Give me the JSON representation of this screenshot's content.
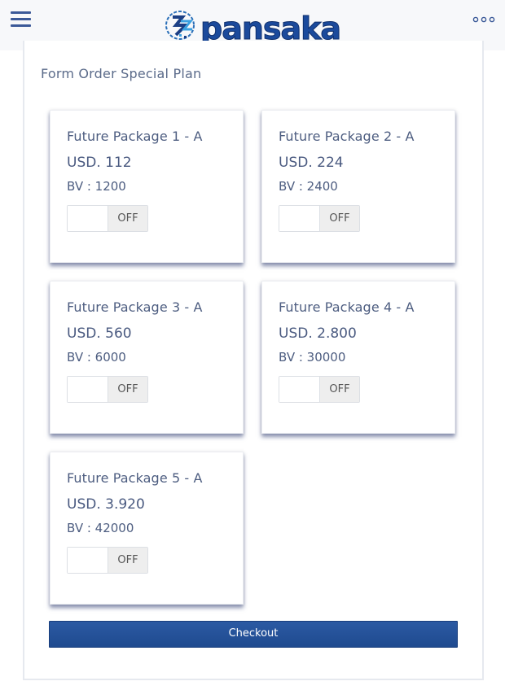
{
  "header": {
    "menu_icon": "hamburger-menu-icon",
    "logo_text": "pansaka",
    "more_icon": "more-options-icon"
  },
  "form": {
    "title": "Form Order Special Plan",
    "packages": [
      {
        "name": "Future Package 1 - A",
        "price": "USD. 112",
        "bv": "BV : 1200",
        "toggle": "OFF"
      },
      {
        "name": "Future Package 2 - A",
        "price": "USD. 224",
        "bv": "BV : 2400",
        "toggle": "OFF"
      },
      {
        "name": "Future Package 3 - A",
        "price": "USD. 560",
        "bv": "BV : 6000",
        "toggle": "OFF"
      },
      {
        "name": "Future Package 4 - A",
        "price": "USD. 2.800",
        "bv": "BV : 30000",
        "toggle": "OFF"
      },
      {
        "name": "Future Package 5 - A",
        "price": "USD. 3.920",
        "bv": "BV : 42000",
        "toggle": "OFF"
      }
    ],
    "checkout_label": "Checkout"
  },
  "colors": {
    "brand_blue": "#1f4a8f",
    "text_slate": "#4d5d80",
    "toggle_off_bg": "#eeeeee"
  }
}
